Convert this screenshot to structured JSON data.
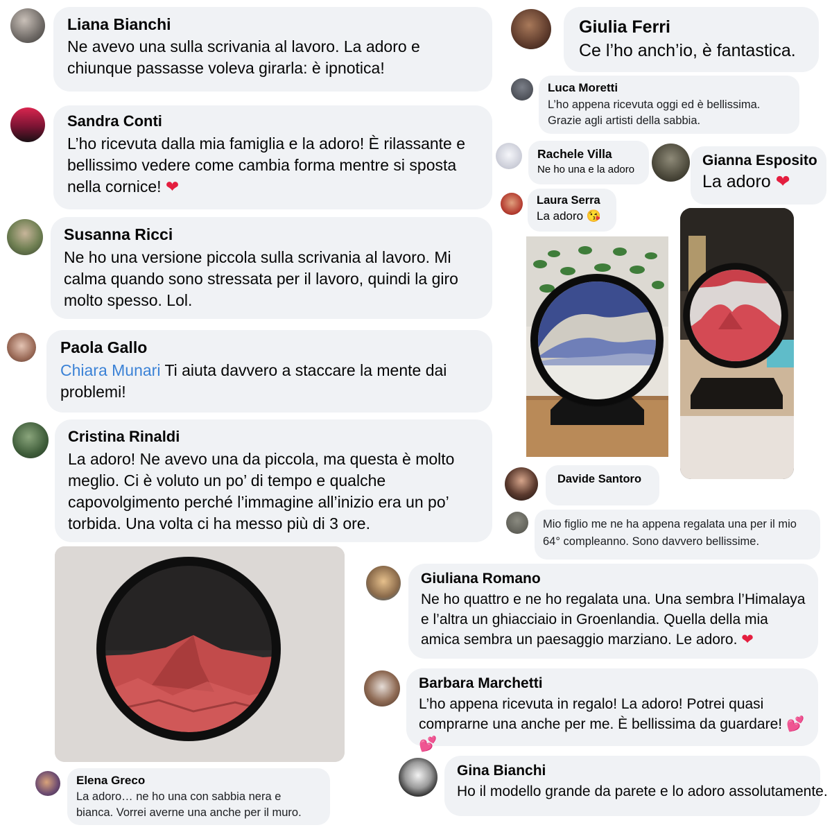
{
  "comments": {
    "liana": {
      "name": "Liana Bianchi",
      "text": "Ne avevo una sulla scrivania al lavoro. La adoro e chiunque passasse voleva girarla: è ipnotica!"
    },
    "giulia": {
      "name": "Giulia Ferri",
      "text": "Ce l’ho anch’io, è fantastica."
    },
    "luca": {
      "name": "Luca Moretti",
      "text": "L’ho appena ricevuta oggi ed è bellissima. Grazie agli artisti della sabbia."
    },
    "sandra": {
      "name": "Sandra Conti",
      "text": "L’ho ricevuta dalla mia famiglia e la adoro! È rilassante e bellissimo vedere come cambia forma mentre si sposta nella cornice!",
      "emoji": "❤"
    },
    "rachele": {
      "name": "Rachele Villa",
      "text": "Ne ho una e la adoro"
    },
    "gianna": {
      "name": "Gianna Esposito",
      "text": "La adoro",
      "emoji": "❤"
    },
    "laura": {
      "name": "Laura Serra",
      "text": "La adoro",
      "emoji": "😘"
    },
    "susanna": {
      "name": "Susanna Ricci",
      "text": "Ne ho una versione piccola sulla scrivania al lavoro. Mi calma quando sono stressata per il lavoro, quindi la giro molto spesso. Lol."
    },
    "paola": {
      "name": "Paola Gallo",
      "mention": "Chiara Munari",
      "text": "Ti aiuta davvero a staccare la mente dai problemi!"
    },
    "cristina": {
      "name": "Cristina Rinaldi",
      "text": "La adoro! Ne avevo una da piccola, ma questa è molto meglio. Ci è voluto un po’ di tempo e qualche capovolgimento perché l’immagine all’inizio era un po’ torbida. Una volta ci ha messo più di 3 ore."
    },
    "davide": {
      "name": "Davide Santoro"
    },
    "figlio": {
      "text": "Mio figlio me ne ha appena regalata una per il mio 64° compleanno. Sono davvero bellissime."
    },
    "giuliana": {
      "name": "Giuliana Romano",
      "text": "Ne ho quattro e ne ho regalata una. Una sembra l’Himalaya e l’altra un ghiacciaio in Groenlandia. Quella della mia amica sembra un paesaggio marziano. Le adoro.",
      "emoji": "❤"
    },
    "barbara": {
      "name": "Barbara Marchetti",
      "text": "L’ho appena ricevuta in regalo! La adoro! Potrei quasi comprarne una anche per me. È bellissima da guardare!",
      "emoji": "💕💕"
    },
    "elena": {
      "name": "Elena Greco",
      "text": "La adoro… ne ho una con sabbia nera e bianca. Vorrei averne una anche per il muro."
    },
    "gina": {
      "name": "Gina Bianchi",
      "text": "Ho il modello grande da parete e lo adoro assolutamente."
    }
  },
  "photos": {
    "blue_sand_frame": "blue-sand-art-photo",
    "red_sand_frame_desk": "red-sand-art-desk-photo",
    "red_sand_frame_wall": "red-sand-art-wall-photo"
  }
}
